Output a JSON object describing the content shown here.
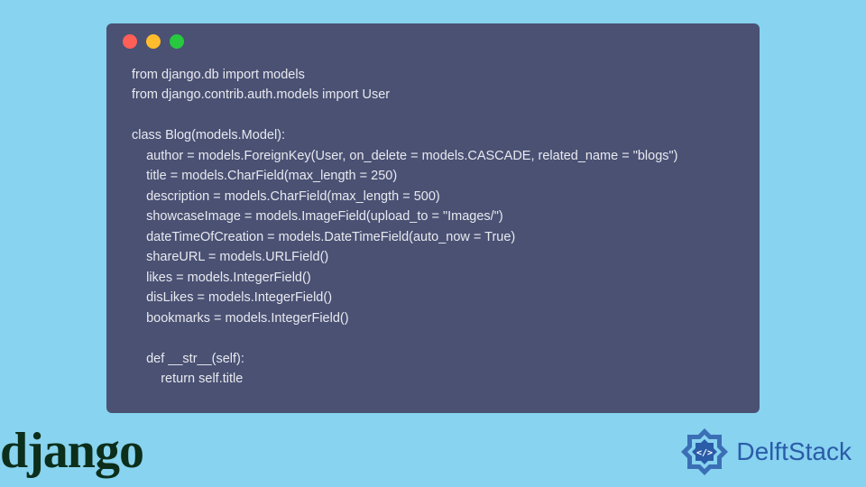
{
  "code": {
    "line1": "from django.db import models",
    "line2": "from django.contrib.auth.models import User",
    "line3": "",
    "line4": "class Blog(models.Model):",
    "line5": "    author = models.ForeignKey(User, on_delete = models.CASCADE, related_name = \"blogs\")",
    "line6": "    title = models.CharField(max_length = 250)",
    "line7": "    description = models.CharField(max_length = 500)",
    "line8": "    showcaseImage = models.ImageField(upload_to = \"Images/\")",
    "line9": "    dateTimeOfCreation = models.DateTimeField(auto_now = True)",
    "line10": "    shareURL = models.URLField()",
    "line11": "    likes = models.IntegerField()",
    "line12": "    disLikes = models.IntegerField()",
    "line13": "    bookmarks = models.IntegerField()",
    "line14": "",
    "line15": "    def __str__(self):",
    "line16": "        return self.title"
  },
  "logos": {
    "django": "django",
    "delftstack": "DelftStack"
  }
}
